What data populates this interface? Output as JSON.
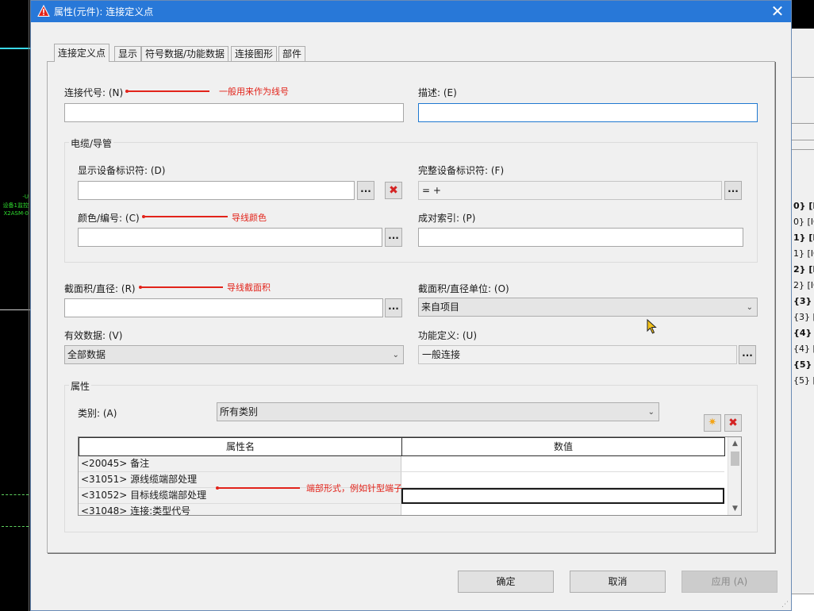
{
  "background": {
    "left_text": [
      "-U",
      "设备1监控",
      "X2ASM-0"
    ],
    "right_rows": [
      {
        "text": "0} [I",
        "bold": true
      },
      {
        "text": "0} [IC",
        "bold": false
      },
      {
        "text": "1} [I",
        "bold": true
      },
      {
        "text": "1} [IC",
        "bold": false
      },
      {
        "text": "2} [I",
        "bold": true
      },
      {
        "text": "2} [IC",
        "bold": false
      },
      {
        "text": "{3} [",
        "bold": true
      },
      {
        "text": "{3} [",
        "bold": false
      },
      {
        "text": "{4} [",
        "bold": true
      },
      {
        "text": "{4} [",
        "bold": false
      },
      {
        "text": "{5} [",
        "bold": true
      },
      {
        "text": "{5} [",
        "bold": false
      }
    ]
  },
  "dialog": {
    "title": "属性(元件): 连接定义点",
    "close_label": "✕",
    "tabs": [
      {
        "label": "连接定义点",
        "active": true
      },
      {
        "label": "显示",
        "active": false
      },
      {
        "label": "符号数据/功能数据",
        "active": false
      },
      {
        "label": "连接图形",
        "active": false
      },
      {
        "label": "部件",
        "active": false
      }
    ],
    "connection_code": {
      "label": "连接代号: (N)",
      "value": ""
    },
    "description": {
      "label": "描述: (E)",
      "value": ""
    },
    "cable_group": {
      "title": "电缆/导管",
      "display_device_id": {
        "label": "显示设备标识符: (D)",
        "value": ""
      },
      "full_device_id": {
        "label": "完整设备标识符: (F)",
        "value": "= +"
      },
      "color_number": {
        "label": "颜色/编号: (C)",
        "value": ""
      },
      "pair_index": {
        "label": "成对索引: (P)",
        "value": ""
      }
    },
    "cross_section": {
      "label": "截面积/直径: (R)",
      "value": ""
    },
    "cross_section_unit": {
      "label": "截面积/直径单位: (O)",
      "value": "来自项目"
    },
    "valid_data": {
      "label": "有效数据: (V)",
      "value": "全部数据"
    },
    "function_definition": {
      "label": "功能定义: (U)",
      "value": "一般连接"
    },
    "properties_group": {
      "title": "属性",
      "category_label": "类别: (A)",
      "category_value": "所有类别",
      "columns": [
        "属性名",
        "数值"
      ],
      "rows": [
        {
          "name": "<20045> 备注",
          "value": ""
        },
        {
          "name": "<31051> 源线缆端部处理",
          "value": ""
        },
        {
          "name": "<31052> 目标线缆端部处理",
          "value": ""
        },
        {
          "name": "<31048> 连接:类型代号",
          "value": ""
        }
      ]
    },
    "buttons": {
      "ok": "确定",
      "cancel": "取消",
      "apply": "应用 (A)"
    },
    "ellipsis": "..."
  },
  "annotations": {
    "wire_number": "一般用来作为线号",
    "wire_color": "导线颜色",
    "wire_cross_section": "导线截面积",
    "end_treatment": "端部形式，例如针型端子"
  },
  "colors": {
    "title_bar": "#2878d8",
    "annotation": "#e2231a",
    "focus_border": "#1f78d0"
  }
}
